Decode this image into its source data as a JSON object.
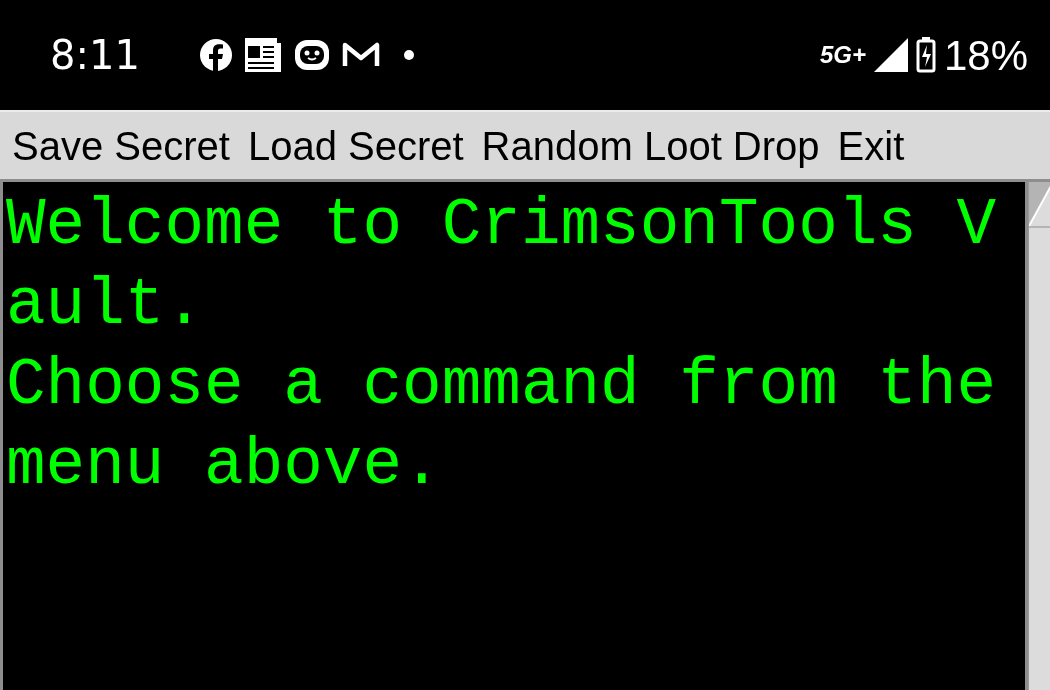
{
  "status_bar": {
    "time": "8:11",
    "network": "5G+",
    "battery": "18%"
  },
  "menu": [
    "Save Secret",
    "Load Secret",
    "Random Loot Drop",
    "Exit"
  ],
  "console": {
    "lines": [
      "Welcome to CrimsonTools Vault.",
      "Choose a command from the menu above."
    ]
  }
}
